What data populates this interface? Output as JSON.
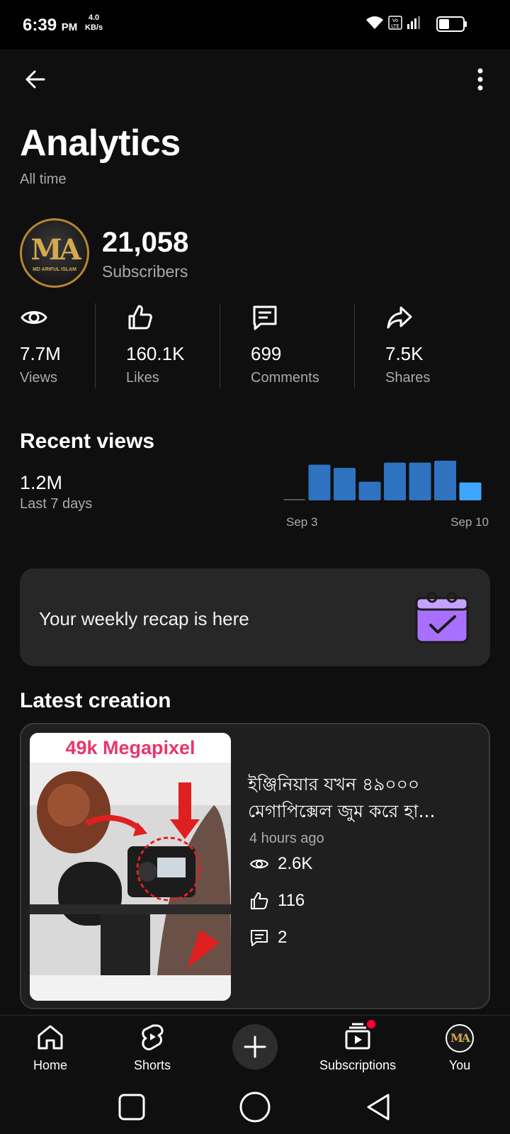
{
  "status_bar": {
    "time": "6:39",
    "ampm": "PM",
    "speed_value": "4.0",
    "speed_unit": "KB/s",
    "volte": "Vo LTE"
  },
  "header": {
    "title": "Analytics",
    "subtitle": "All time"
  },
  "channel": {
    "subscribers": "21,058",
    "subscribers_label": "Subscribers",
    "avatar_monogram": "MA",
    "avatar_text": "MD ARIFUL ISLAM"
  },
  "stats": [
    {
      "icon": "eye-icon",
      "value": "7.7M",
      "label": "Views"
    },
    {
      "icon": "thumbs-up-icon",
      "value": "160.1K",
      "label": "Likes"
    },
    {
      "icon": "comment-icon",
      "value": "699",
      "label": "Comments"
    },
    {
      "icon": "share-icon",
      "value": "7.5K",
      "label": "Shares"
    }
  ],
  "recent_views": {
    "title": "Recent views",
    "value": "1.2M",
    "period": "Last 7 days",
    "start_label": "Sep 3",
    "end_label": "Sep 10"
  },
  "chart_data": {
    "type": "bar",
    "categories": [
      "Sep 3",
      "",
      "",
      "",
      "",
      "",
      "",
      "Sep 10"
    ],
    "values": [
      0.02,
      0.9,
      0.82,
      0.47,
      0.95,
      0.95,
      1.0,
      0.45
    ],
    "highlight_last": true,
    "colors": {
      "bar": "#2e72c0",
      "last_bar": "#3ea6ff",
      "baseline": "#555555"
    }
  },
  "recap": {
    "text": "Your weekly recap is here",
    "icon": "calendar-check-icon"
  },
  "latest_creation": {
    "title": "Latest creation",
    "thumbnail_headline": "49k Megapixel",
    "video_title": "ইঞ্জিনিয়ার যখন ৪৯০০০ মেগাপিক্সেল জুম করে হা...",
    "time": "4 hours ago",
    "views": "2.6K",
    "likes": "116",
    "comments": "2"
  },
  "bottom_nav": [
    {
      "label": "Home",
      "icon": "home-icon"
    },
    {
      "label": "Shorts",
      "icon": "shorts-icon"
    },
    {
      "label": "",
      "icon": "create-plus-icon"
    },
    {
      "label": "Subscriptions",
      "icon": "subscriptions-icon"
    },
    {
      "label": "You",
      "icon": "avatar"
    }
  ],
  "colors": {
    "background": "#0f0f0f",
    "card": "#272727",
    "accent": "#3ea6ff",
    "recap_purple": "#a970ff",
    "thumb_pink": "#e8366b",
    "notification": "#ff0033"
  }
}
